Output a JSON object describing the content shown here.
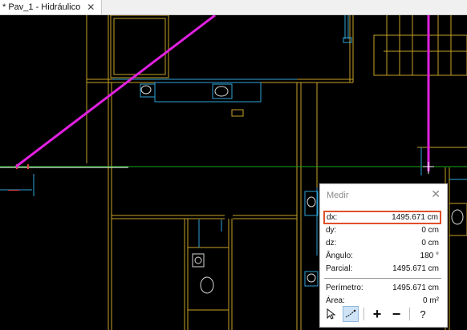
{
  "tab": {
    "title": "* Pav_1 - Hidráulico"
  },
  "panel": {
    "title": "Medir",
    "rows": [
      {
        "label": "dx:",
        "value": "1495.671 cm"
      },
      {
        "label": "dy:",
        "value": "0 cm"
      },
      {
        "label": "dz:",
        "value": "0 cm"
      },
      {
        "label": "Ângulo:",
        "value": "180 °"
      },
      {
        "label": "Parcial:",
        "value": "1495.671 cm"
      },
      {
        "label": "Perímetro:",
        "value": "1495.671 cm"
      },
      {
        "label": "Área:",
        "value": "0 m²"
      }
    ],
    "help_label": "?"
  },
  "colors": {
    "wall": "#c9a227",
    "pipe": "#2fa3d8",
    "measure_line": "#e020e0",
    "horizon": "#19a819",
    "highlight": "#e0502a"
  }
}
